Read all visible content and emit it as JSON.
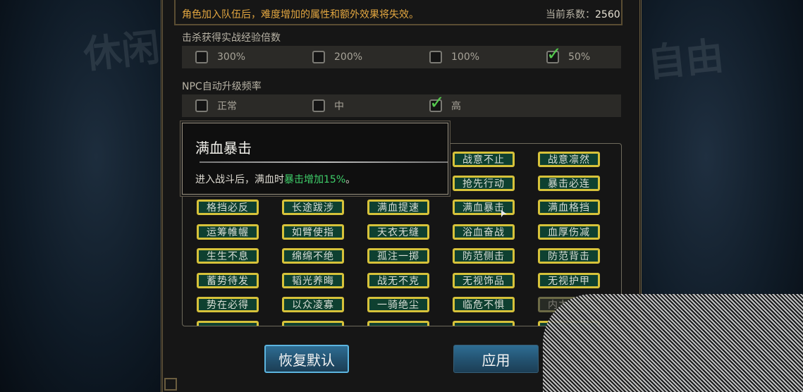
{
  "header": {
    "notice": "角色加入队伍后，难度增加的属性和额外效果将失效。",
    "coef_label": "当前系数：",
    "coef_value": "2560"
  },
  "background": {
    "left_char": "休闲",
    "right_char": "自由"
  },
  "exp_section": {
    "title": "击杀获得实战经验倍数",
    "options": [
      {
        "label": "300%",
        "checked": false
      },
      {
        "label": "200%",
        "checked": false
      },
      {
        "label": "100%",
        "checked": false
      },
      {
        "label": "50%",
        "checked": true
      }
    ]
  },
  "npc_section": {
    "title": "NPC自动升级频率",
    "options": [
      {
        "label": "正常",
        "checked": false
      },
      {
        "label": "中",
        "checked": false
      },
      {
        "label": "高",
        "checked": true
      }
    ]
  },
  "tooltip": {
    "title": "满血暴击",
    "desc_prefix": "进入战斗后，满血时",
    "desc_highlight": "暴击增加15%",
    "desc_suffix": "。"
  },
  "traits": [
    [
      "",
      "",
      "",
      "战意不止",
      "战意凛然"
    ],
    [
      "",
      "",
      "",
      "抢先行动",
      "暴击必连"
    ],
    [
      "格挡必反",
      "长途跋涉",
      "满血提速",
      "满血暴击",
      "满血格挡"
    ],
    [
      "运筹帷幄",
      "如臂使指",
      "天衣无缝",
      "浴血奋战",
      "血厚伤减"
    ],
    [
      "生生不息",
      "绵绵不绝",
      "孤注一掷",
      "防范侧击",
      "防范背击"
    ],
    [
      "蓄势待发",
      "韬光养晦",
      "战无不克",
      "无视饰品",
      "无视护甲"
    ],
    [
      "势在必得",
      "以众凌寡",
      "一骑绝尘",
      "临危不惧",
      "内力反震"
    ]
  ],
  "buttons": {
    "reset": "恢复默认",
    "apply": "应用"
  },
  "colors": {
    "accent_orange": "#e2a640",
    "check_green": "#55c84e",
    "tag_border": "#d6c23a",
    "highlight_green": "#3fcf6a"
  }
}
